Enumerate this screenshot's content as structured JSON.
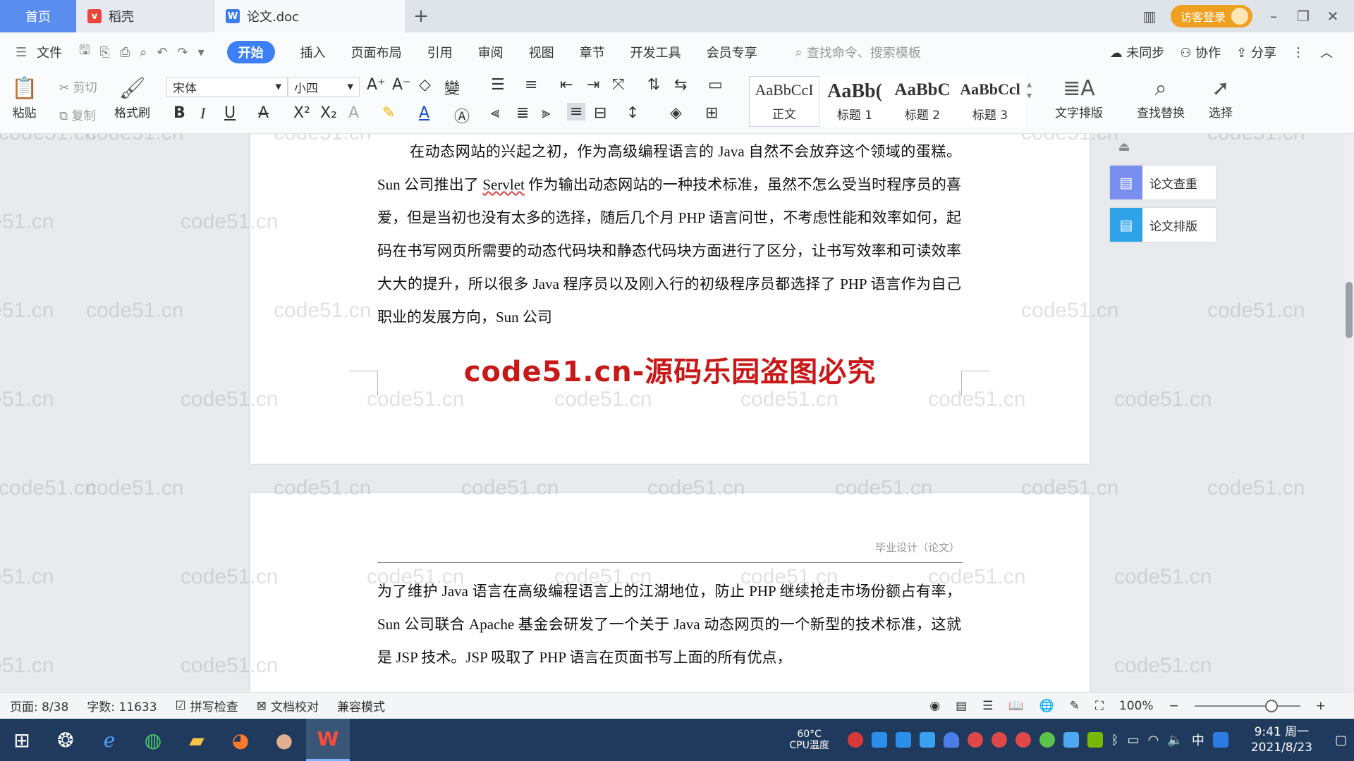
{
  "titlebar": {
    "home_tab": "首页",
    "straw_tab": "稻壳",
    "doc_tab": "论文.doc",
    "add_tab": "+",
    "login_label": "访客登录"
  },
  "menubar": {
    "file": "文件",
    "items": [
      "开始",
      "插入",
      "页面布局",
      "引用",
      "审阅",
      "视图",
      "章节",
      "开发工具",
      "会员专享"
    ],
    "active": "开始",
    "search_placeholder": "查找命令、搜索模板",
    "sync": "未同步",
    "collab": "协作",
    "share": "分享"
  },
  "ribbon": {
    "paste": "粘贴",
    "cut": "剪切",
    "copy": "复制",
    "format_painter": "格式刷",
    "font_name": "宋体",
    "font_size": "小四",
    "styles": [
      {
        "preview": "AaBbCcI",
        "name": "正文"
      },
      {
        "preview": "AaBb(",
        "name": "标题 1"
      },
      {
        "preview": "AaBbC",
        "name": "标题 2"
      },
      {
        "preview": "AaBbCcl",
        "name": "标题 3"
      }
    ],
    "text_layout": "文字排版",
    "find_replace": "查找替换",
    "select": "选择"
  },
  "document": {
    "page1_text_a": "在动态网站的兴起之初，作为高级编程语言的 Java 自然不会放弃这个领域的蛋糕。Sun 公司推出了 ",
    "page1_text_servlet": "Servlet",
    "page1_text_b": " 作为输出动态网站的一种技术标准，虽然不怎么受当时程序员的喜爱，但是当初也没有太多的选择，随后几个月 PHP 语言问世，不考虑性能和效率如何，起码在书写网页所需要的动态代码块和静态代码块方面进行了区分，让书写效率和可读效率大大的提升，所以很多 Java 程序员以及刚入行的初级程序员都选择了 PHP 语言作为自己职业的发展方向，Sun 公司",
    "overlay_banner": "code51.cn-源码乐园盗图必究",
    "page2_header": "毕业设计（论文）",
    "page2_text": "为了维护 Java 语言在高级编程语言上的江湖地位，防止 PHP 继续抢走市场份额占有率，Sun 公司联合 Apache 基金会研发了一个关于 Java 动态网页的一个新型的技术标准，这就是 JSP 技术。JSP 吸取了 PHP 语言在页面书写上面的所有优点，"
  },
  "watermark_text": "code51.cn",
  "right_panel": {
    "check": "论文查重",
    "layout": "论文排版"
  },
  "statusbar": {
    "page": "页面: 8/38",
    "words": "字数: 11633",
    "spell": "拼写检查",
    "proof": "文档校对",
    "compat": "兼容模式",
    "zoom": "100%"
  },
  "taskbar": {
    "cpu_temp": "60°C",
    "cpu_label": "CPU温度",
    "ime": "中",
    "time": "9:41 周一",
    "date": "2021/8/23"
  },
  "colors": {
    "accent": "#3d7ff5",
    "home_tab": "#5b8def",
    "login": "#f0a020",
    "banner": "#c81818",
    "taskbar": "#1f3a5c"
  }
}
